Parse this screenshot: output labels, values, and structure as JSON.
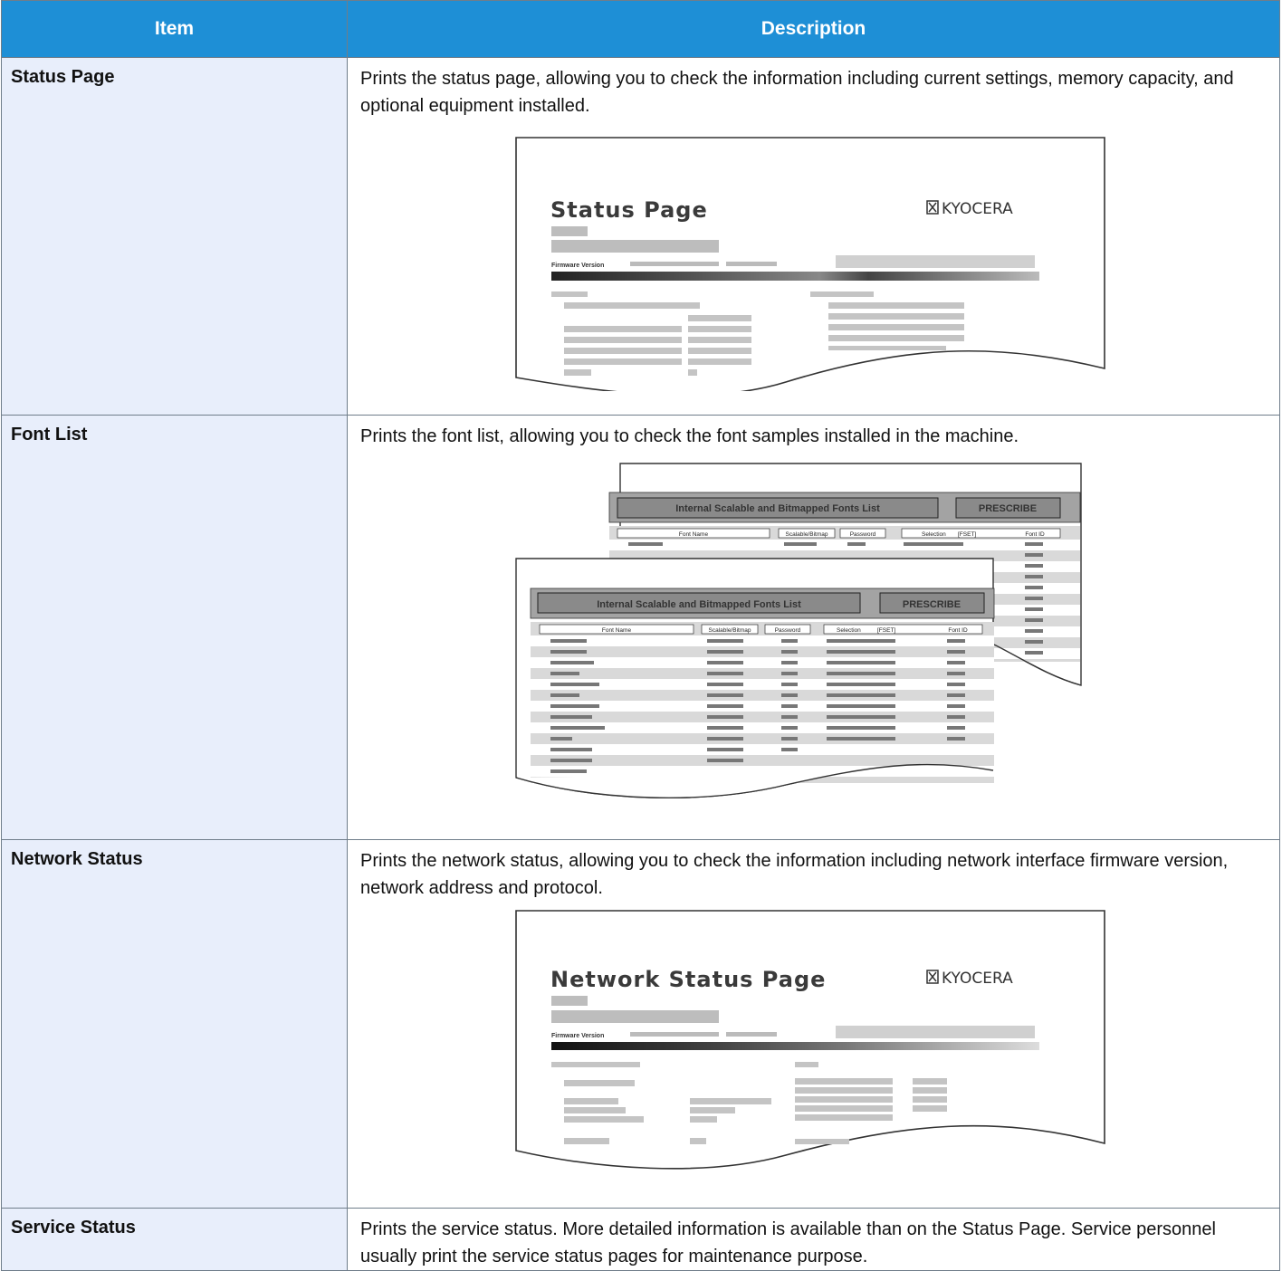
{
  "table": {
    "headers": {
      "item": "Item",
      "description": "Description"
    },
    "rows": [
      {
        "item": "Status Page",
        "description": "Prints the status page, allowing you to check the information including current settings, memory capacity, and optional equipment installed."
      },
      {
        "item": "Font List",
        "description": "Prints the font list, allowing you to check the font samples installed in the machine."
      },
      {
        "item": "Network Status",
        "description": "Prints the network status, allowing you to check the information including network interface firmware version, network address and protocol."
      },
      {
        "item": "Service Status",
        "description": "Prints the service status. More detailed information is available than on the Status Page. Service personnel usually print the service status pages for maintenance purpose."
      }
    ]
  },
  "illustrations": {
    "status_page": {
      "title": "Status Page",
      "logo": "KYOCERA",
      "firmware_label": "Firmware Version"
    },
    "font_list": {
      "title": "Internal Scalable and Bitmapped Fonts List",
      "badge": "PRESCRIBE",
      "columns": [
        "Font Name",
        "Scalable/Bitmap",
        "Password",
        "Selection",
        "[FSET]",
        "Font ID"
      ]
    },
    "network_status": {
      "title": "Network Status Page",
      "logo": "KYOCERA",
      "firmware_label": "Firmware Version"
    }
  }
}
